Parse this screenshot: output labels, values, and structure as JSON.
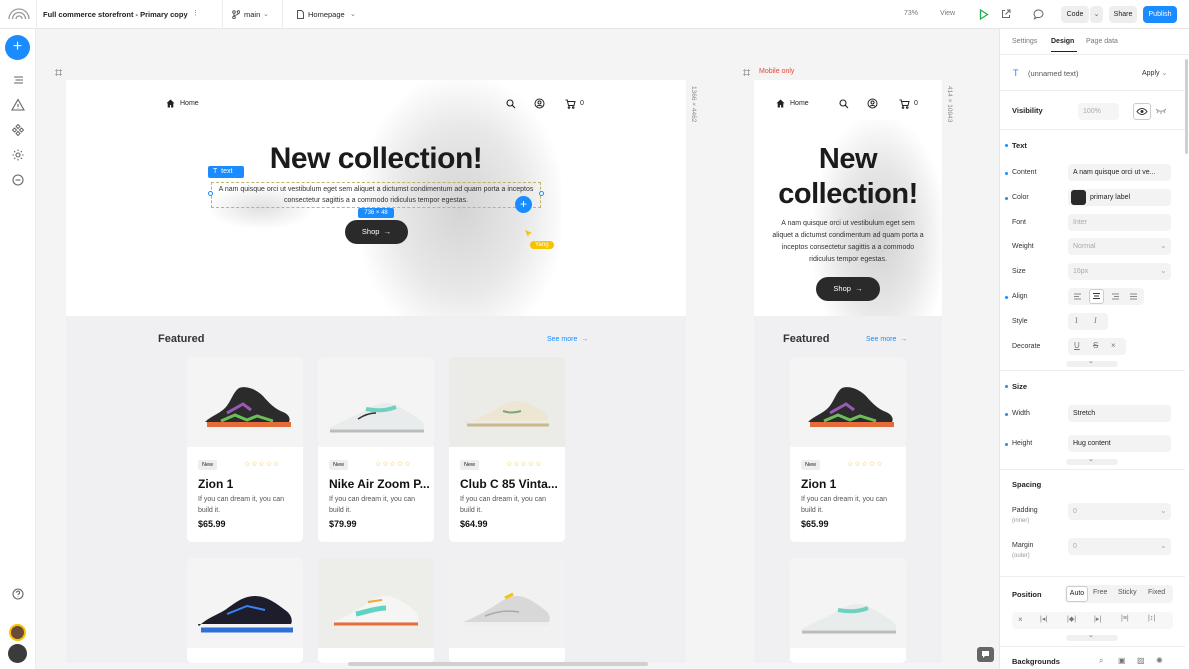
{
  "topbar": {
    "project": "Full commerce storefront - Primary copy",
    "branch": "main",
    "page": "Homepage",
    "zoom": "73%",
    "view": "View",
    "code": "Code",
    "share": "Share",
    "publish": "Publish"
  },
  "canvas": {
    "desktop": {
      "size_label": "1366 × 4462",
      "nav_home": "Home",
      "cart_count": "0",
      "hero_title": "New collection!",
      "hero_text": "A nam quisque orci ut vestibulum eget sem aliquet a dictumst condimentum ad quam porta a inceptos consectetur sagittis a a commodo ridiculus tempor egestas.",
      "shop": "Shop",
      "selection_tag": "text",
      "selection_size": "736 × 48",
      "cursor_user": "Yang",
      "featured": "Featured",
      "see_more": "See more"
    },
    "mobile": {
      "frame_label": "Mobile only",
      "size_label": "414 × 10943",
      "nav_home": "Home",
      "cart_count": "0",
      "hero_title_1": "New",
      "hero_title_2": "collection!",
      "hero_text": "A nam quisque orci ut vestibulum eget sem aliquet a dictumst condimentum ad quam porta a inceptos consectetur sagittis a a commodo ridiculus tempor egestas.",
      "shop": "Shop",
      "featured": "Featured",
      "see_more": "See more"
    },
    "products": [
      {
        "badge": "New",
        "name": "Zion 1",
        "desc": "If you can dream it, you can build it.",
        "price": "$65.99"
      },
      {
        "badge": "New",
        "name": "Nike Air Zoom P...",
        "desc": "If you can dream it, you can build it.",
        "price": "$79.99"
      },
      {
        "badge": "New",
        "name": "Club C 85 Vinta...",
        "desc": "If you can dream it, you can build it.",
        "price": "$64.99"
      }
    ],
    "stars": "☆☆☆☆☆"
  },
  "panel": {
    "tabs": [
      "Settings",
      "Design",
      "Page data"
    ],
    "active_tab": "Design",
    "element_name": "(unnamed text)",
    "apply": "Apply",
    "visibility_label": "Visibility",
    "visibility_value": "100%",
    "text_section": "Text",
    "content_label": "Content",
    "content_value": "A nam quisque orci ut ve...",
    "color_label": "Color",
    "color_value": "primary label",
    "font_label": "Font",
    "font_value": "Inter",
    "weight_label": "Weight",
    "weight_value": "Normal",
    "size_label": "Size",
    "size_value": "16px",
    "align_label": "Align",
    "style_label": "Style",
    "decorate_label": "Decorate",
    "size_section": "Size",
    "width_label": "Width",
    "width_value": "Stretch",
    "height_label": "Height",
    "height_value": "Hug content",
    "spacing_section": "Spacing",
    "padding_label": "Padding",
    "padding_sub": "(inner)",
    "padding_value": "0",
    "margin_label": "Margin",
    "margin_sub": "(outer)",
    "margin_value": "0",
    "position_section": "Position",
    "position_options": [
      "Auto",
      "Free",
      "Sticky",
      "Fixed"
    ],
    "backgrounds_section": "Backgrounds"
  },
  "colors": {
    "accent": "#1a8cff",
    "star": "#f2c12e",
    "cursor": "#f5c400",
    "mobile_label": "#e5483a"
  }
}
